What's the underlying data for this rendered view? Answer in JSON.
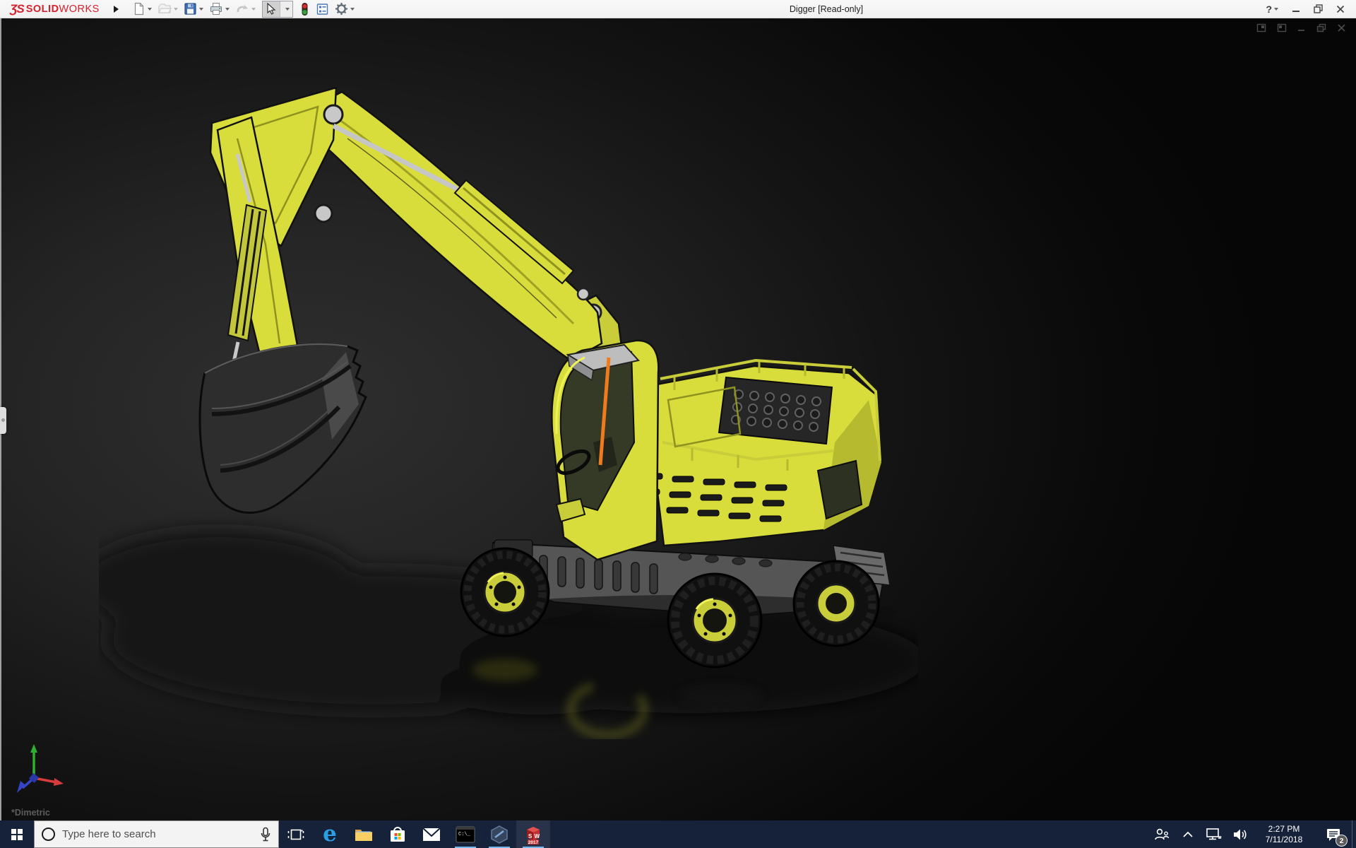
{
  "titlebar": {
    "logo_mark": "ƷS",
    "logo_solid": "SOLID",
    "logo_works": "WORKS",
    "title": "Digger [Read-only]",
    "help_label": "?",
    "toolbar_icons": [
      "new-document",
      "open",
      "save",
      "print",
      "undo",
      "select",
      "rebuild",
      "file-properties",
      "options"
    ]
  },
  "viewport": {
    "orientation_label": "*Dimetric",
    "window_controls": [
      "pane-left",
      "pane-right",
      "minimize",
      "restore",
      "close"
    ],
    "triad_axes": {
      "x": "#d83b3b",
      "y": "#2fae2f",
      "z": "#3545c8"
    }
  },
  "taskbar": {
    "search_placeholder": "Type here to search",
    "edge_glyph": "e",
    "cmd_text": "C:\\_",
    "sw_s": "S",
    "sw_w": "W",
    "sw_year": "2017",
    "tray": {
      "time": "2:27 PM",
      "date": "7/11/2018",
      "badge_count": "2"
    }
  },
  "colors": {
    "accent_red": "#d6212d",
    "taskbar_bg": "#16213a",
    "running_indicator": "#76b9ed",
    "machine_yellow": "#d9dd3b",
    "titlebar_bg": "#f4f4f4"
  }
}
